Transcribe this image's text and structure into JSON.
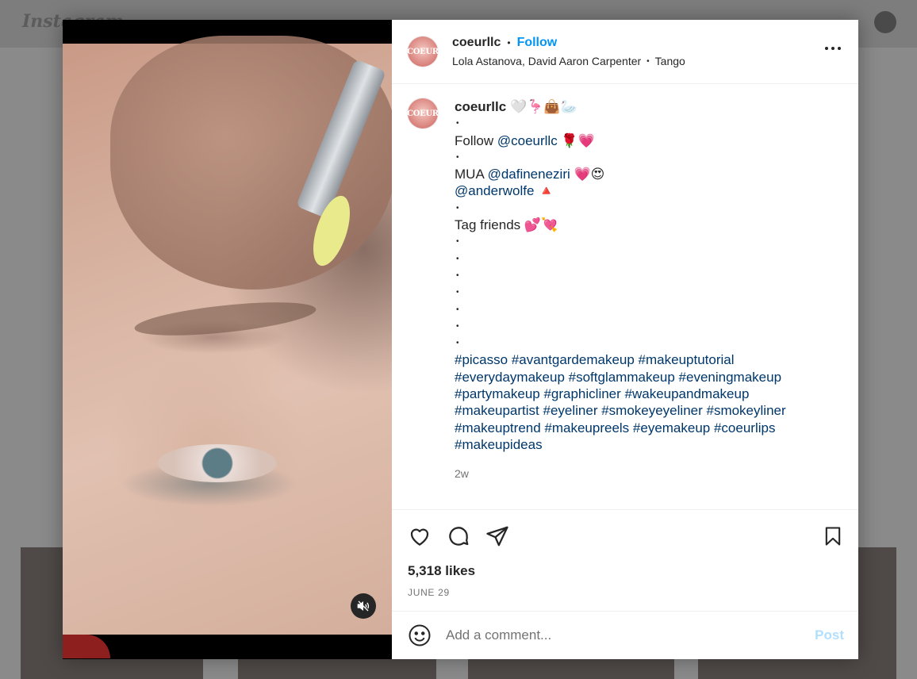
{
  "background": {
    "logo_text": "Instagram"
  },
  "post": {
    "avatar_text": "COEUR",
    "username": "coeurllc",
    "follow_label": "Follow",
    "audio_artists": "Lola Astanova, David Aaron Carpenter",
    "audio_track": "Tango",
    "more_icon": "more-horizontal-icon"
  },
  "caption": {
    "username": "coeurllc",
    "username_emoji": "🤍🦩👜🦢",
    "line_follow_prefix": "Follow ",
    "follow_mention": "@coeurllc",
    "follow_emoji": " 🌹💗",
    "line_mua_prefix": "MUA ",
    "mua_mention": "@dafineneziri",
    "mua_emoji": " 💗😍",
    "second_mention": "@anderwolfe",
    "second_emoji": " 🔺",
    "tag_friends": "Tag friends 💕💘",
    "bullet": "•",
    "hashtags": "#picasso #avantgardemakeup #makeuptutorial #everydaymakeup #softglammakeup #eveningmakeup #partymakeup #graphicliner #wakeupandmakeup #makeupartist #eyeliner #smokeyeyeliner #smokeyliner #makeuptrend #makeupreels #eyemakeup #coeurlips #makeupideas",
    "time_ago": "2w"
  },
  "actions": {
    "likes": "5,318 likes",
    "date": "JUNE 29"
  },
  "comment": {
    "placeholder": "Add a comment...",
    "post_label": "Post"
  },
  "colors": {
    "link": "#00376b",
    "follow": "#0095f6",
    "post_disabled": "#b2dffc",
    "secondary_text": "#737373"
  }
}
